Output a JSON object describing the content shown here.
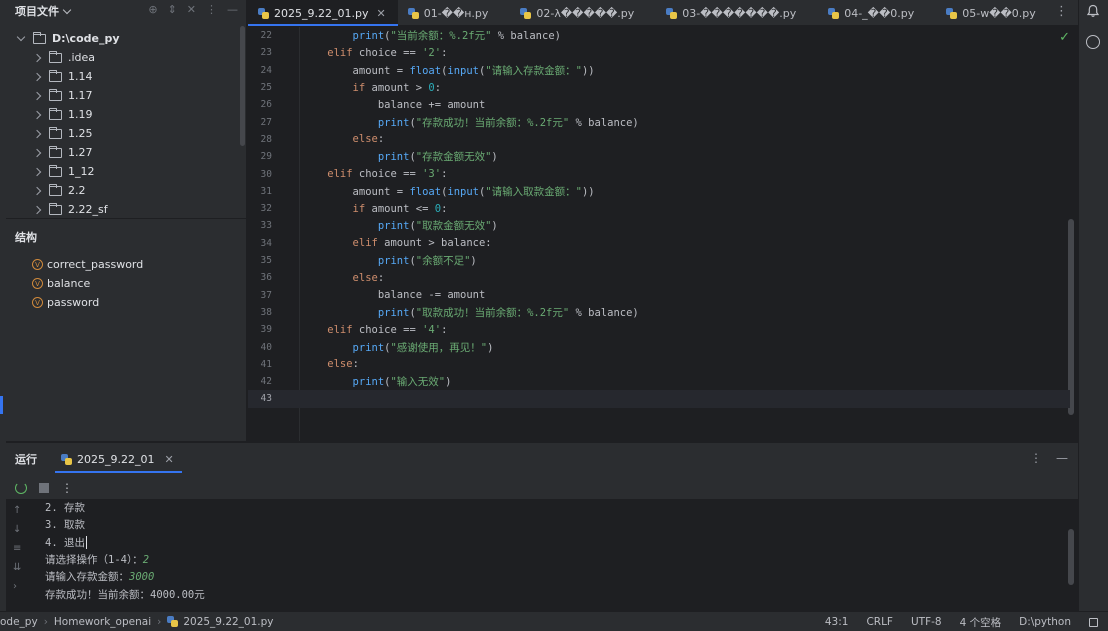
{
  "project": {
    "title": "项目文件",
    "root": "D:\\code_py",
    "folders": [
      ".idea",
      "1.14",
      "1.17",
      "1.19",
      "1.25",
      "1.27",
      "1_12",
      "2.2",
      "2.22_sf"
    ]
  },
  "structure": {
    "title": "结构",
    "items": [
      "correct_password",
      "balance",
      "password"
    ],
    "badge": "V"
  },
  "tabs": [
    {
      "label": "2025_9.22_01.py",
      "active": true
    },
    {
      "label": "01-��н.py",
      "active": false
    },
    {
      "label": "02-λ�����.py",
      "active": false
    },
    {
      "label": "03-�������.py",
      "active": false
    },
    {
      "label": "04-_��0.py",
      "active": false
    },
    {
      "label": "05-w��0.py",
      "active": false
    }
  ],
  "editor": {
    "lines": [
      {
        "n": "22",
        "indent": 8,
        "tokens": [
          [
            "fn",
            "print"
          ],
          [
            "t",
            "("
          ],
          [
            "str",
            "\"当前余额：%.2f元\""
          ],
          [
            "t",
            " % balance)"
          ]
        ]
      },
      {
        "n": "23",
        "indent": 4,
        "tokens": [
          [
            "kw",
            "elif"
          ],
          [
            "t",
            " choice == "
          ],
          [
            "str",
            "'2'"
          ],
          [
            "t",
            ":"
          ]
        ]
      },
      {
        "n": "24",
        "indent": 8,
        "tokens": [
          [
            "t",
            "amount = "
          ],
          [
            "fn",
            "float"
          ],
          [
            "t",
            "("
          ],
          [
            "fn",
            "input"
          ],
          [
            "t",
            "("
          ],
          [
            "str",
            "\"请输入存款金额：\""
          ],
          [
            "t",
            "))"
          ]
        ]
      },
      {
        "n": "25",
        "indent": 8,
        "tokens": [
          [
            "kw",
            "if"
          ],
          [
            "t",
            " amount > "
          ],
          [
            "num",
            "0"
          ],
          [
            "t",
            ":"
          ]
        ]
      },
      {
        "n": "26",
        "indent": 12,
        "tokens": [
          [
            "t",
            "balance += amount"
          ]
        ]
      },
      {
        "n": "27",
        "indent": 12,
        "tokens": [
          [
            "fn",
            "print"
          ],
          [
            "t",
            "("
          ],
          [
            "str",
            "\"存款成功！当前余额：%.2f元\""
          ],
          [
            "t",
            " % balance)"
          ]
        ]
      },
      {
        "n": "28",
        "indent": 8,
        "tokens": [
          [
            "kw",
            "else"
          ],
          [
            "t",
            ":"
          ]
        ]
      },
      {
        "n": "29",
        "indent": 12,
        "tokens": [
          [
            "fn",
            "print"
          ],
          [
            "t",
            "("
          ],
          [
            "str",
            "\"存款金额无效\""
          ],
          [
            "t",
            ")"
          ]
        ]
      },
      {
        "n": "30",
        "indent": 4,
        "tokens": [
          [
            "kw",
            "elif"
          ],
          [
            "t",
            " choice == "
          ],
          [
            "str",
            "'3'"
          ],
          [
            "t",
            ":"
          ]
        ]
      },
      {
        "n": "31",
        "indent": 8,
        "tokens": [
          [
            "t",
            "amount = "
          ],
          [
            "fn",
            "float"
          ],
          [
            "t",
            "("
          ],
          [
            "fn",
            "input"
          ],
          [
            "t",
            "("
          ],
          [
            "str",
            "\"请输入取款金额：\""
          ],
          [
            "t",
            "))"
          ]
        ]
      },
      {
        "n": "32",
        "indent": 8,
        "tokens": [
          [
            "kw",
            "if"
          ],
          [
            "t",
            " amount <= "
          ],
          [
            "num",
            "0"
          ],
          [
            "t",
            ":"
          ]
        ]
      },
      {
        "n": "33",
        "indent": 12,
        "tokens": [
          [
            "fn",
            "print"
          ],
          [
            "t",
            "("
          ],
          [
            "str",
            "\"取款金额无效\""
          ],
          [
            "t",
            ")"
          ]
        ]
      },
      {
        "n": "34",
        "indent": 8,
        "tokens": [
          [
            "kw",
            "elif"
          ],
          [
            "t",
            " amount > balance:"
          ]
        ]
      },
      {
        "n": "35",
        "indent": 12,
        "tokens": [
          [
            "fn",
            "print"
          ],
          [
            "t",
            "("
          ],
          [
            "str",
            "\"余额不足\""
          ],
          [
            "t",
            ")"
          ]
        ]
      },
      {
        "n": "36",
        "indent": 8,
        "tokens": [
          [
            "kw",
            "else"
          ],
          [
            "t",
            ":"
          ]
        ]
      },
      {
        "n": "37",
        "indent": 12,
        "tokens": [
          [
            "t",
            "balance -= amount"
          ]
        ]
      },
      {
        "n": "38",
        "indent": 12,
        "tokens": [
          [
            "fn",
            "print"
          ],
          [
            "t",
            "("
          ],
          [
            "str",
            "\"取款成功！当前余额：%.2f元\""
          ],
          [
            "t",
            " % balance)"
          ]
        ]
      },
      {
        "n": "39",
        "indent": 4,
        "tokens": [
          [
            "kw",
            "elif"
          ],
          [
            "t",
            " choice == "
          ],
          [
            "str",
            "'4'"
          ],
          [
            "t",
            ":"
          ]
        ]
      },
      {
        "n": "40",
        "indent": 8,
        "tokens": [
          [
            "fn",
            "print"
          ],
          [
            "t",
            "("
          ],
          [
            "str",
            "\"感谢使用，再见！\""
          ],
          [
            "t",
            ")"
          ]
        ]
      },
      {
        "n": "41",
        "indent": 4,
        "tokens": [
          [
            "kw",
            "else"
          ],
          [
            "t",
            ":"
          ]
        ]
      },
      {
        "n": "42",
        "indent": 8,
        "tokens": [
          [
            "fn",
            "print"
          ],
          [
            "t",
            "("
          ],
          [
            "str",
            "\"输入无效\""
          ],
          [
            "t",
            ")"
          ]
        ]
      },
      {
        "n": "43",
        "indent": 0,
        "tokens": []
      }
    ],
    "current_line": "43"
  },
  "run": {
    "title": "运行",
    "tab": "2025_9.22_01",
    "output": [
      {
        "text": "2. 存款",
        "input": ""
      },
      {
        "text": "3. 取款",
        "input": ""
      },
      {
        "text": "4. 退出",
        "input": "",
        "caret": true
      },
      {
        "text": "请选择操作（1-4）：",
        "input": "2"
      },
      {
        "text": "请输入存款金额：",
        "input": "3000"
      },
      {
        "text": "存款成功！当前余额：4000.00元",
        "input": ""
      }
    ]
  },
  "status": {
    "breadcrumb": [
      "ode_py",
      "Homework_openai",
      "2025_9.22_01.py"
    ],
    "position": "43:1",
    "line_sep": "CRLF",
    "encoding": "UTF-8",
    "indent": "4 个空格",
    "interpreter": "D:\\python"
  },
  "colors": {
    "accent": "#3574f0",
    "keyword": "#cf8e6d",
    "string": "#6aab73",
    "function": "#56a8f5",
    "number": "#2aacb8"
  }
}
